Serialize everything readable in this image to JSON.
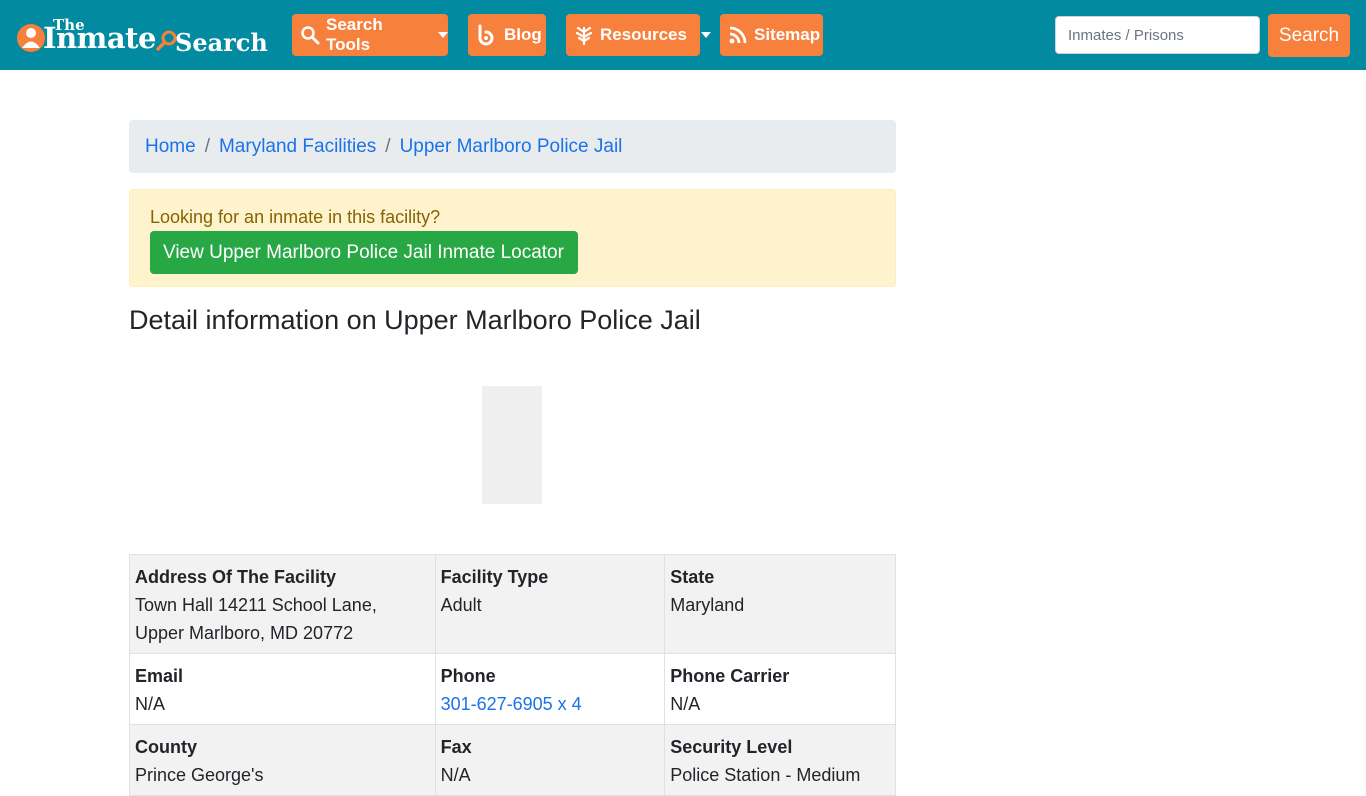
{
  "logo": {
    "the": "The",
    "inmate": "Inmate",
    "search": "Search"
  },
  "nav": {
    "search_tools": "Search Tools",
    "blog": "Blog",
    "resources": "Resources",
    "sitemap": "Sitemap"
  },
  "search": {
    "placeholder": "Inmates / Prisons",
    "button": "Search"
  },
  "breadcrumb": {
    "home": "Home",
    "state": "Maryland Facilities",
    "facility": "Upper Marlboro Police Jail"
  },
  "alert": {
    "message": "Looking for an inmate in this facility?",
    "button": "View Upper Marlboro Police Jail Inmate Locator"
  },
  "page_title": "Detail information on Upper Marlboro Police Jail",
  "details": {
    "address_label": "Address Of The Facility",
    "address_line1": "Town Hall 14211 School Lane,",
    "address_line2": "Upper Marlboro, MD 20772",
    "type_label": "Facility Type",
    "type_value": "Adult",
    "state_label": "State",
    "state_value": "Maryland",
    "email_label": "Email",
    "email_value": "N/A",
    "phone_label": "Phone",
    "phone_value": "301-627-6905 x 4",
    "carrier_label": "Phone Carrier",
    "carrier_value": "N/A",
    "county_label": "County",
    "county_value": "Prince George's",
    "fax_label": "Fax",
    "fax_value": "N/A",
    "security_label": "Security Level",
    "security_value": "Police Station - Medium"
  },
  "colors": {
    "navbar": "#028aa0",
    "accent_orange": "#f7803c",
    "link_blue": "#1a73e8",
    "success_green": "#28a745",
    "alert_bg": "#fff3cd"
  }
}
